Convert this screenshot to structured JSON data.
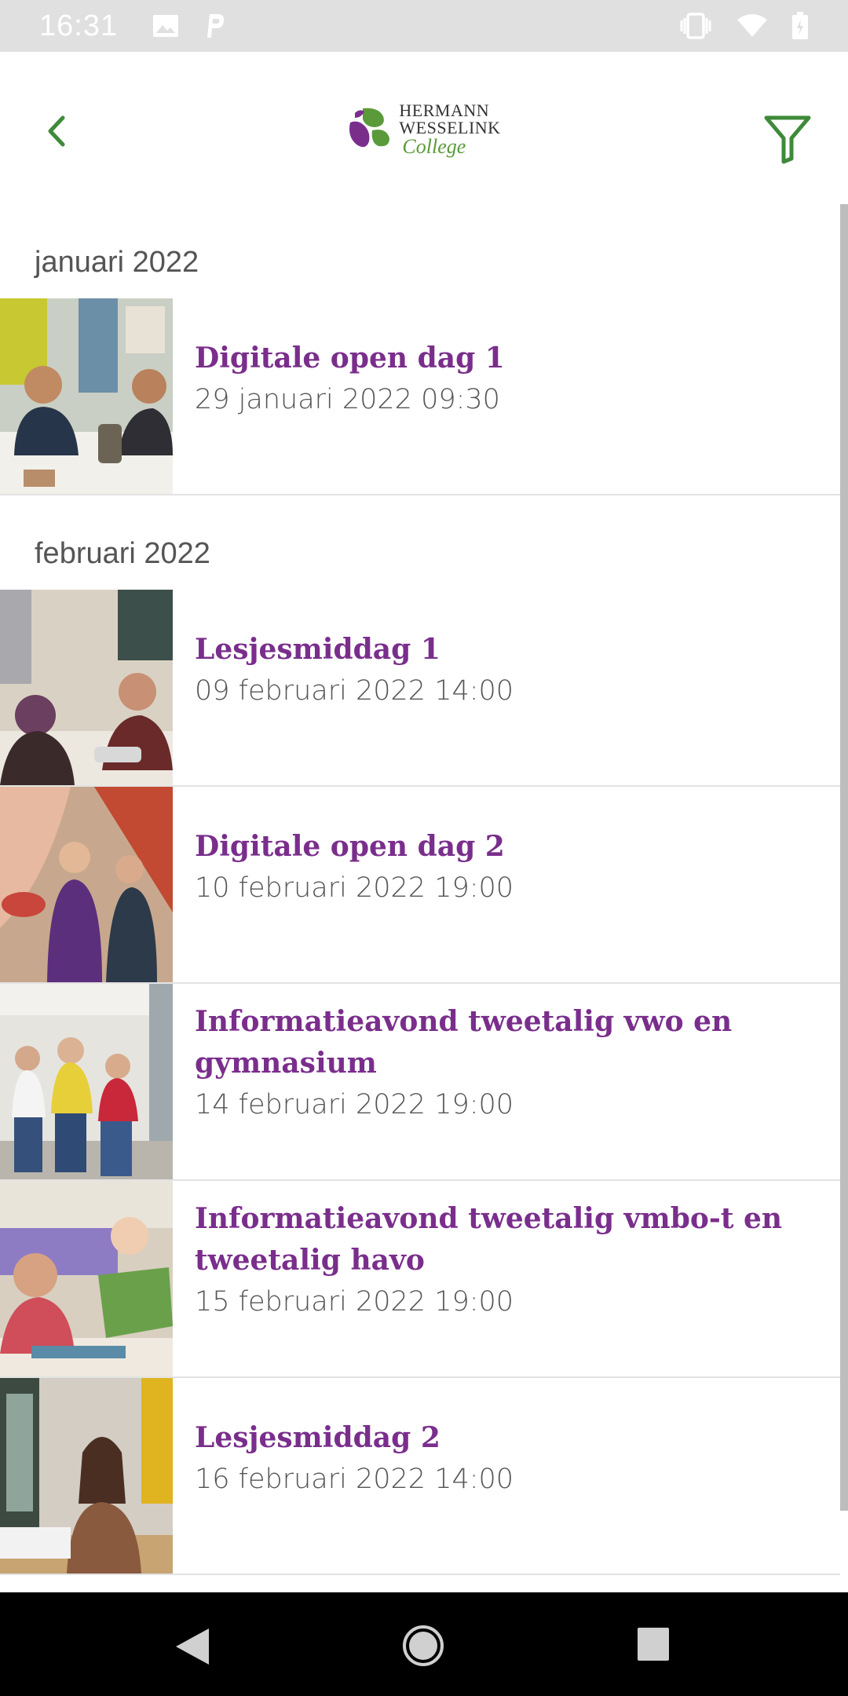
{
  "status_bar": {
    "time": "16:31",
    "left_icons": [
      "image-icon",
      "parking-icon"
    ],
    "right_icons": [
      "vibrate-icon",
      "wifi-icon",
      "battery-icon"
    ]
  },
  "app_bar": {
    "logo_line1": "HERMANN",
    "logo_line2": "WESSELINK",
    "logo_line3": "College",
    "colors": {
      "accent": "#3f8a3a",
      "title": "#7a2e8c"
    }
  },
  "sections": [
    {
      "header": "januari 2022",
      "events": [
        {
          "title": "Digitale open dag 1",
          "date": "29 januari 2022 09:30"
        }
      ]
    },
    {
      "header": "februari 2022",
      "events": [
        {
          "title": "Lesjesmiddag 1",
          "date": "09 februari 2022 14:00"
        },
        {
          "title": "Digitale open dag 2",
          "date": "10 februari 2022 19:00"
        },
        {
          "title": "Informatieavond tweetalig vwo en gymnasium",
          "date": "14 februari 2022 19:00"
        },
        {
          "title": "Informatieavond tweetalig vmbo-t en tweetalig havo",
          "date": "15 februari 2022 19:00"
        },
        {
          "title": "Lesjesmiddag 2",
          "date": "16 februari 2022 14:00"
        }
      ]
    }
  ],
  "nav_bar": {
    "icons": [
      "back-nav-icon",
      "home-nav-icon",
      "recents-nav-icon"
    ]
  }
}
